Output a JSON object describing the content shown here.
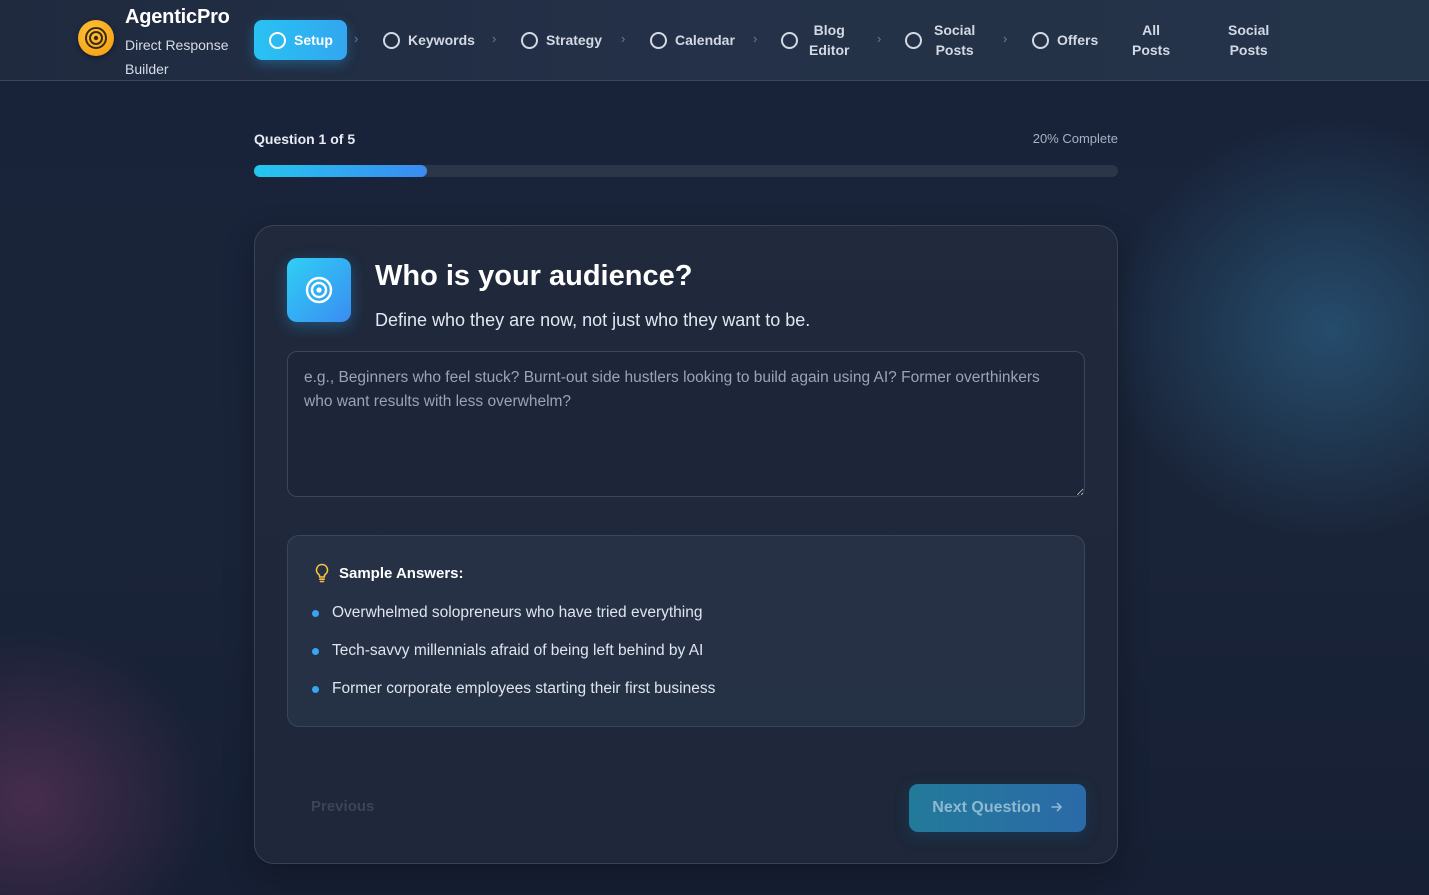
{
  "brand": {
    "title": "AgenticPro",
    "subtitle": "Direct Response Builder",
    "logo_icon": "target-icon",
    "accent": "#f7a614"
  },
  "nav": {
    "setup": "Setup",
    "keywords": "Keywords",
    "strategy": "Strategy",
    "calendar": "Calendar",
    "blog_editor_1": "Blog",
    "blog_editor_2": "Editor",
    "social_posts_1": "Social",
    "social_posts_2": "Posts",
    "offers": "Offers",
    "all_posts_1": "All",
    "all_posts_2": "Posts",
    "social_posts_b_1": "Social",
    "social_posts_b_2": "Posts",
    "separator": "›",
    "active_color": "#29b6f2"
  },
  "progress": {
    "question_label": "Question 1 of 5",
    "complete_label": "20% Complete",
    "fraction": 0.2
  },
  "question": {
    "title": "Who is your audience?",
    "subtitle": "Define who they are now, not just who they want to be.",
    "icon": "target-icon",
    "answer_value": "",
    "answer_placeholder": "e.g., Beginners who feel stuck? Burnt-out side hustlers looking to build again using AI? Former overthinkers who want results with less overwhelm?"
  },
  "samples": {
    "heading": "Sample Answers:",
    "icon": "lightbulb-icon",
    "items": [
      "Overwhelmed solopreneurs who have tried everything",
      "Tech-savvy millennials afraid of being left behind by AI",
      "Former corporate employees starting their first business"
    ]
  },
  "buttons": {
    "previous": "Previous",
    "next": "Next Question",
    "next_icon": "arrow-right-icon"
  }
}
